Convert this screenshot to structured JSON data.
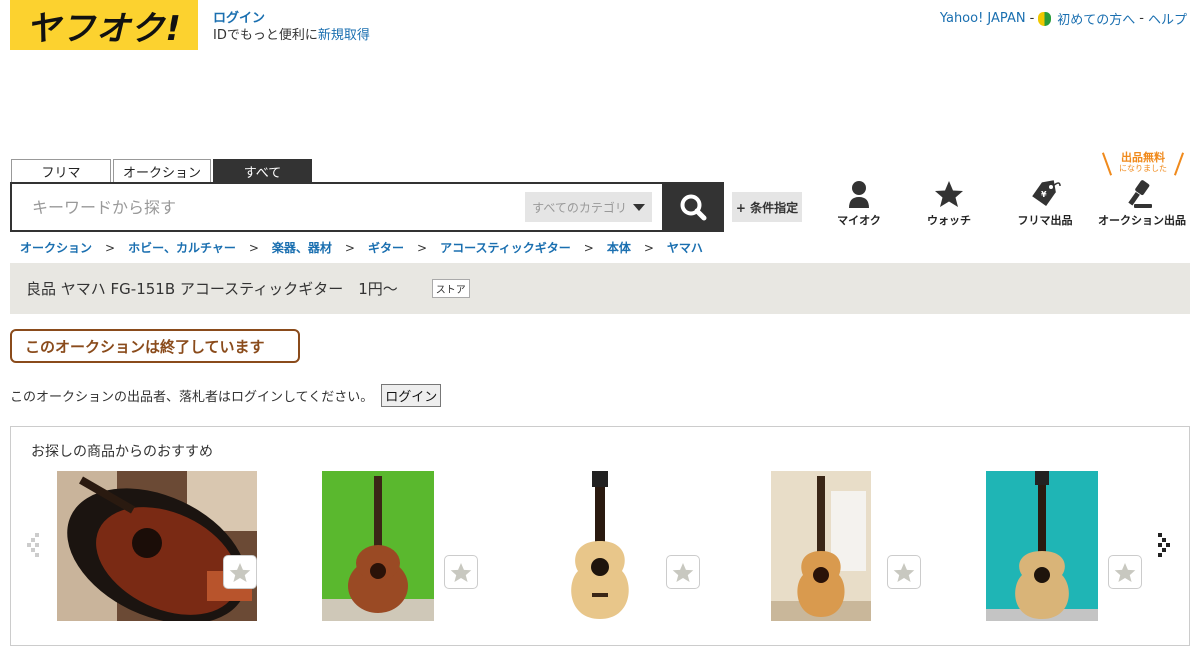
{
  "header": {
    "logo_text": "ヤフオク!",
    "login_label": "ログイン",
    "login_sub_text": "IDでもっと便利に",
    "register_label": "新規取得",
    "links": [
      "Yahoo! JAPAN",
      "初めての方へ",
      "ヘルプ"
    ],
    "link_separator": "-"
  },
  "tabs": [
    "フリマ",
    "オークション",
    "すべて"
  ],
  "search": {
    "placeholder": "キーワードから探す",
    "category": "すべてのカテゴリ",
    "condition_label": "+ 条件指定"
  },
  "nav": {
    "items": [
      "マイオク",
      "ウォッチ",
      "フリマ出品",
      "オークション出品"
    ],
    "free_badge_title": "出品無料",
    "free_badge_sub": "になりました"
  },
  "breadcrumb": [
    "オークション",
    "ホビー、カルチャー",
    "楽器、器材",
    "ギター",
    "アコースティックギター",
    "本体",
    "ヤマハ"
  ],
  "item": {
    "title": "良品 ヤマハ FG-151B アコースティックギター　1円～",
    "store_badge": "ストア",
    "ended_text": "このオークションは終了しています",
    "notice_text": "このオークションの出品者、落札者はログインしてください。",
    "notice_button": "ログイン"
  },
  "recommend": {
    "title": "お探しの商品からのおすすめ"
  },
  "colors": {
    "brand_yellow": "#fcd22f",
    "link_blue": "#1a6fb0",
    "ended_brown": "#8a4b1b",
    "title_bar_bg": "#e8e7e2",
    "free_orange": "#f08a1c"
  }
}
